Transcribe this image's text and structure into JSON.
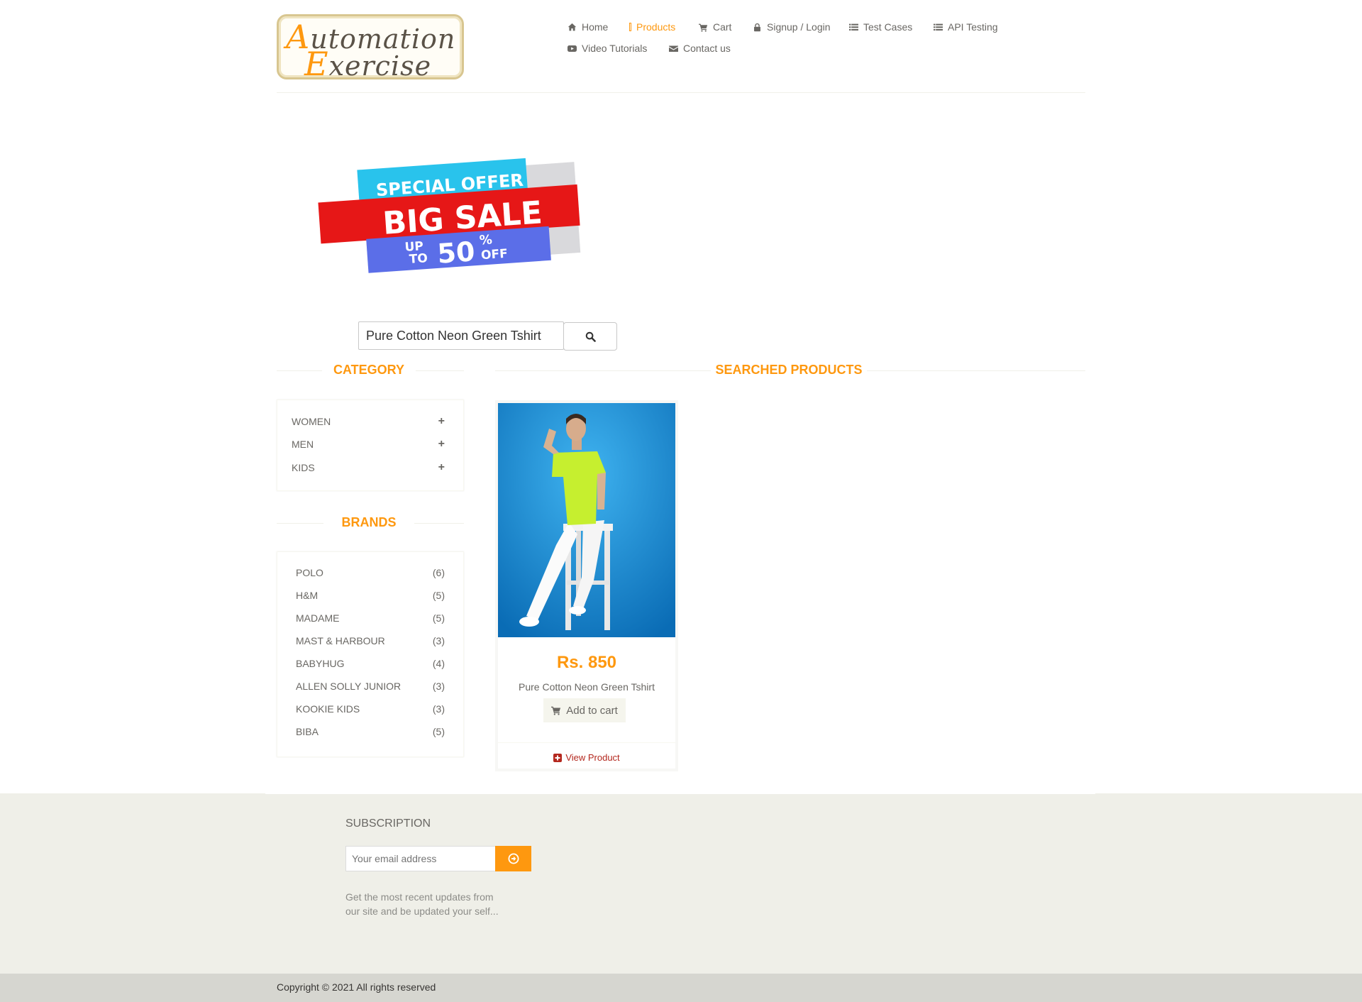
{
  "logo": {
    "line1_cap": "A",
    "line1_rest": "utomation",
    "line2_cap": "E",
    "line2_rest": "xercise"
  },
  "nav": {
    "home": "Home",
    "products": "Products",
    "cart": "Cart",
    "signup": "Signup / Login",
    "test_cases": "Test Cases",
    "api_testing": "API Testing",
    "video_tutorials": "Video Tutorials",
    "contact": "Contact us"
  },
  "banner": {
    "top": "SPECIAL OFFER",
    "main": "BIG SALE",
    "up_to": "UP",
    "to": "TO",
    "pct": "50",
    "pct_sign": "%",
    "off": "OFF"
  },
  "search": {
    "value": "Pure Cotton Neon Green Tshirt"
  },
  "category": {
    "title": "Category",
    "items": [
      {
        "label": "WOMEN",
        "icon": "plus"
      },
      {
        "label": "MEN",
        "icon": "plus"
      },
      {
        "label": "KIDS",
        "icon": "plus"
      }
    ]
  },
  "brands": {
    "title": "Brands",
    "items": [
      {
        "label": "POLO",
        "count": "(6)"
      },
      {
        "label": "H&M",
        "count": "(5)"
      },
      {
        "label": "MADAME",
        "count": "(5)"
      },
      {
        "label": "MAST & HARBOUR",
        "count": "(3)"
      },
      {
        "label": "BABYHUG",
        "count": "(4)"
      },
      {
        "label": "ALLEN SOLLY JUNIOR",
        "count": "(3)"
      },
      {
        "label": "KOOKIE KIDS",
        "count": "(3)"
      },
      {
        "label": "BIBA",
        "count": "(5)"
      }
    ]
  },
  "searched": {
    "title": "Searched Products",
    "products": [
      {
        "price": "Rs. 850",
        "name": "Pure Cotton Neon Green Tshirt",
        "add_to_cart": "Add to cart",
        "view": "View Product"
      }
    ]
  },
  "subscription": {
    "title": "Subscription",
    "placeholder": "Your email address",
    "text": "Get the most recent updates from our site and be updated your self..."
  },
  "footer": {
    "copyright": "Copyright © 2021 All rights reserved"
  },
  "colors": {
    "accent": "#fe980f",
    "text": "#696763",
    "view_product": "#b4281e",
    "footer_bg": "#efefe8"
  }
}
